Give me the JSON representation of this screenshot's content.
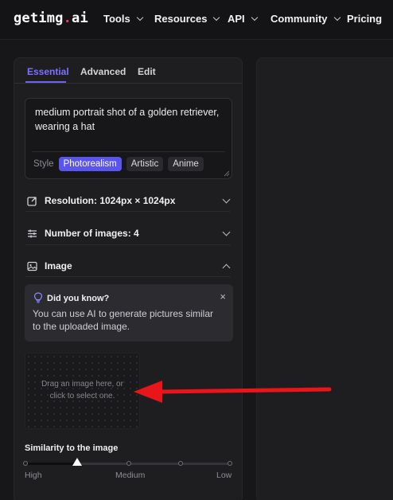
{
  "nav": {
    "logo_main": "getimg",
    "logo_dot": ".",
    "logo_tld": "ai",
    "items": [
      {
        "label": "Tools",
        "has_dropdown": true
      },
      {
        "label": "Resources",
        "has_dropdown": true
      },
      {
        "label": "API",
        "has_dropdown": true
      },
      {
        "label": "Community",
        "has_dropdown": true
      },
      {
        "label": "Pricing",
        "has_dropdown": false
      }
    ]
  },
  "tabs": [
    {
      "label": "Essential",
      "active": true
    },
    {
      "label": "Advanced",
      "active": false
    },
    {
      "label": "Edit",
      "active": false
    }
  ],
  "prompt": {
    "value": "medium portrait shot of a golden retriever, wearing a hat",
    "style_label": "Style",
    "styles": [
      {
        "label": "Photorealism",
        "active": true
      },
      {
        "label": "Artistic",
        "active": false
      },
      {
        "label": "Anime",
        "active": false
      }
    ]
  },
  "settings": {
    "resolution_label": "Resolution: 1024px × 1024px",
    "num_images_label": "Number of images: 4",
    "image_label": "Image"
  },
  "tip": {
    "title": "Did you know?",
    "body": "You can use AI to generate pictures similar to the uploaded image.",
    "close_glyph": "×"
  },
  "dropzone": {
    "line1": "Drag an image here, or",
    "line2": "click to select one."
  },
  "similarity": {
    "title": "Similarity to the image",
    "labels": [
      "High",
      "Medium",
      "Low"
    ],
    "value_fraction": 0.25
  },
  "colors": {
    "accent": "#6c63ff",
    "annotation_arrow": "#e8161b",
    "background": "#17171a"
  },
  "icons": [
    "chevron-down-icon",
    "resize-icon",
    "sliders-icon",
    "image-icon",
    "lightbulb-icon",
    "close-icon",
    "chevron-up-icon"
  ]
}
